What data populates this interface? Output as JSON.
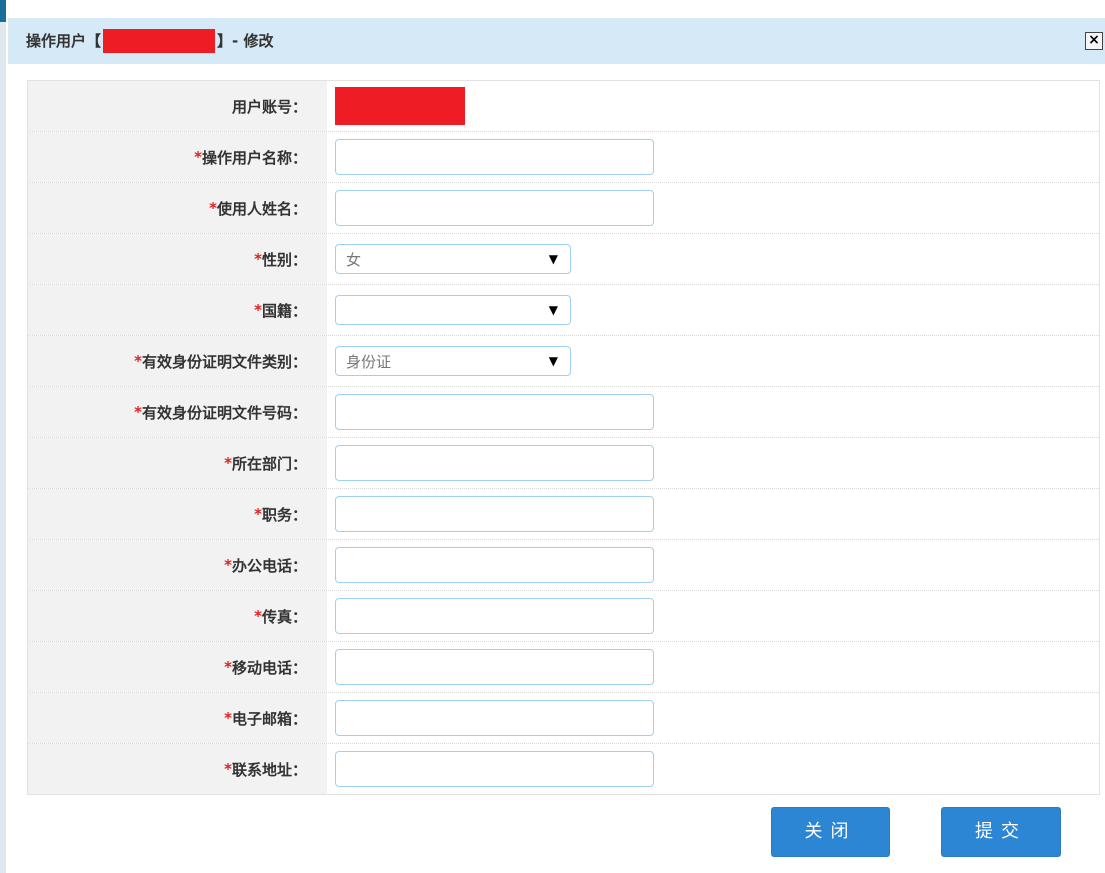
{
  "dialog": {
    "title_prefix": "操作用户【",
    "title_suffix": "】- 修改",
    "close_symbol": "×"
  },
  "form": {
    "required_mark": "*",
    "account": {
      "label": "用户账号："
    },
    "fields": [
      {
        "label": "操作用户名称：",
        "type": "text",
        "value": ""
      },
      {
        "label": "使用人姓名：",
        "type": "text",
        "value": ""
      },
      {
        "label": "性别：",
        "type": "select",
        "value": "女"
      },
      {
        "label": "国籍：",
        "type": "select",
        "value": ""
      },
      {
        "label": "有效身份证明文件类别：",
        "type": "select",
        "value": "身份证"
      },
      {
        "label": "有效身份证明文件号码：",
        "type": "text",
        "value": ""
      },
      {
        "label": "所在部门：",
        "type": "text",
        "value": ""
      },
      {
        "label": "职务：",
        "type": "text",
        "value": ""
      },
      {
        "label": "办公电话：",
        "type": "text",
        "value": ""
      },
      {
        "label": "传真：",
        "type": "text",
        "value": ""
      },
      {
        "label": "移动电话：",
        "type": "text",
        "value": ""
      },
      {
        "label": "电子邮箱：",
        "type": "text",
        "value": ""
      },
      {
        "label": "联系地址：",
        "type": "text",
        "value": ""
      }
    ],
    "select_arrow": "▼"
  },
  "buttons": {
    "close_label": "关闭",
    "submit_label": "提交"
  }
}
